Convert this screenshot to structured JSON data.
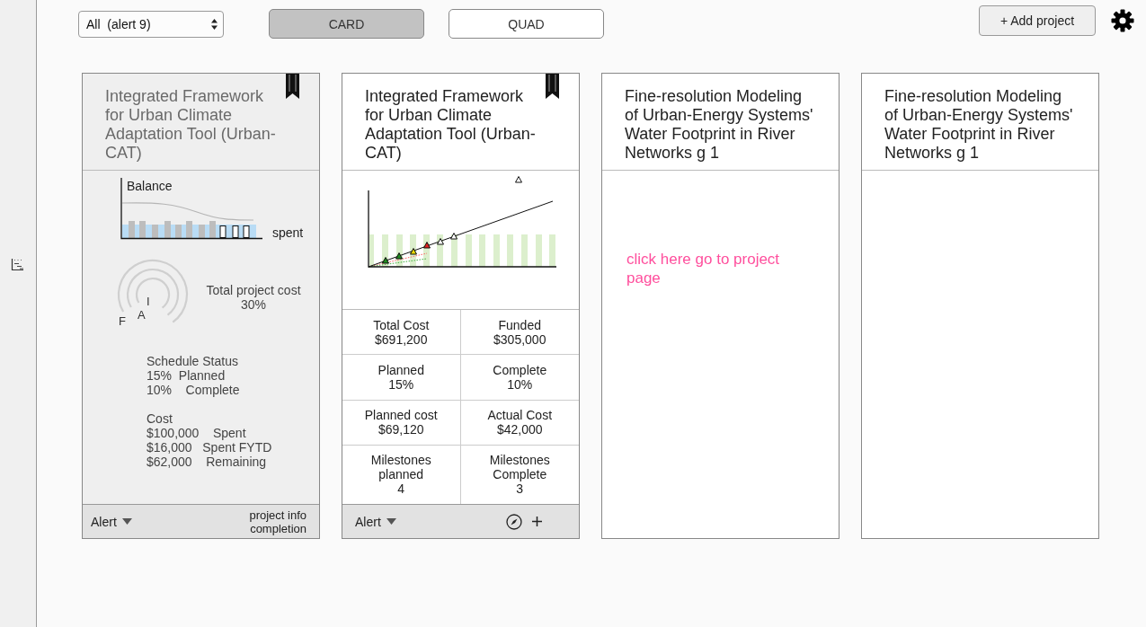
{
  "toolbar": {
    "filter": {
      "value": "All  (alert 9)"
    },
    "views": [
      {
        "label": "CARD",
        "selected": true
      },
      {
        "label": "QUAD",
        "selected": false
      }
    ],
    "add_button": {
      "label": "+ Add project"
    }
  },
  "cards": [
    {
      "kind": "summary",
      "title": "Integrated Framework for Urban Climate Adaptation Tool (Urban-CAT)",
      "bookmarked": true,
      "balance": {
        "label": "Balance",
        "axis_label": "spent"
      },
      "gauge": {
        "labels": [
          "F",
          "A",
          "I"
        ]
      },
      "total_cost": {
        "label": "Total project cost",
        "value": "30%"
      },
      "schedule": {
        "heading": "Schedule Status",
        "lines": [
          "15%  Planned",
          "10%    Complete"
        ]
      },
      "cost": {
        "heading": "Cost",
        "lines": [
          "$100,000    Spent",
          "$16,000   Spent FYTD",
          "$62,000    Remaining"
        ]
      },
      "footer": {
        "alert": "Alert",
        "note": [
          "project info",
          "completion"
        ]
      }
    },
    {
      "kind": "metrics",
      "title": "Integrated Framework for Urban Climate Adaptation Tool (Urban-CAT)",
      "bookmarked": true,
      "stats": [
        {
          "label": "Total Cost",
          "value": "$691,200"
        },
        {
          "label": "Funded",
          "value": "$305,000"
        },
        {
          "label": "Planned",
          "value": "15%"
        },
        {
          "label": "Complete",
          "value": "10%"
        },
        {
          "label": "Planned cost",
          "value": "$69,120"
        },
        {
          "label": "Actual Cost",
          "value": "$42,000"
        },
        {
          "label": "Milestones planned",
          "value": "4"
        },
        {
          "label": "Milestones Complete",
          "value": "3"
        }
      ],
      "footer": {
        "alert": "Alert"
      }
    },
    {
      "kind": "plain",
      "title": "Fine-resolution Modeling of Urban-Energy Systems' Water Footprint in River Networks g 1",
      "bookmarked": false,
      "link": "click here go to project page"
    },
    {
      "kind": "plain",
      "title": "Fine-resolution Modeling of Urban-Energy Systems' Water Footprint in River Networks g 1",
      "bookmarked": false
    }
  ]
}
